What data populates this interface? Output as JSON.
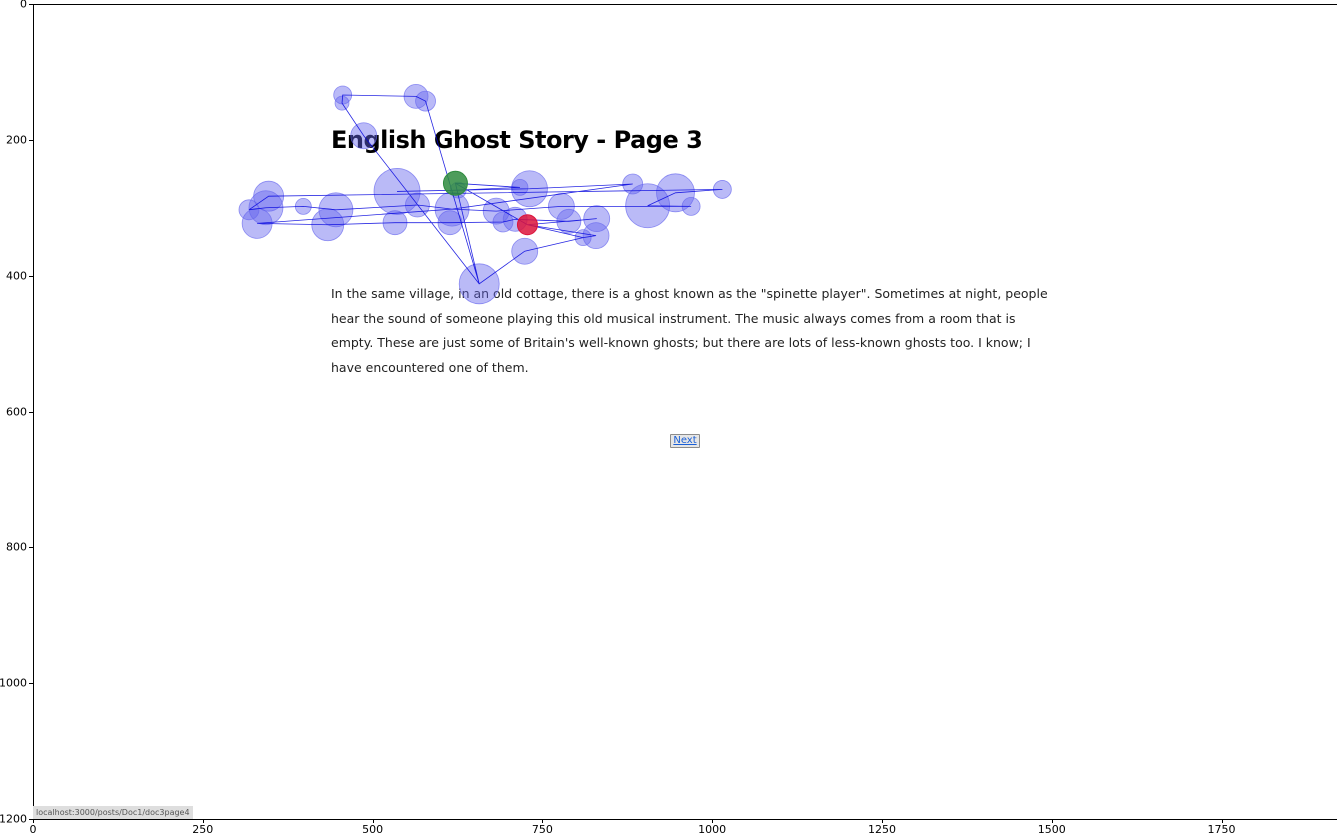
{
  "page": {
    "title": "English Ghost Story - Page 3",
    "paragraph": "In the same village, in an old cottage, there is a ghost known as the \"spinette player\". Sometimes at night, people hear the sound of someone playing this old musical instrument. The music always comes from a room that is empty. These are just some of Britain's well-known ghosts; but there are lots of less-known ghosts too. I know; I have encountered one of them.",
    "next_label": "Next"
  },
  "status_bar": {
    "url": "localhost:3000/posts/Doc1/doc3page4"
  },
  "chart_data": {
    "type": "scatter",
    "title": "",
    "xlabel": "",
    "ylabel": "",
    "xlim": [
      0,
      1920
    ],
    "ylim": [
      1200,
      0
    ],
    "x_ticks": [
      0,
      250,
      500,
      750,
      1000,
      1250,
      1500,
      1750
    ],
    "y_ticks": [
      0,
      200,
      400,
      600,
      800,
      1000,
      1200
    ],
    "grid": false,
    "colors": {
      "fixation": "#6666ee",
      "saccade": "#0000dd",
      "first_fixation": "#2e8b3e",
      "last_fixation": "#dc143c"
    },
    "fixations": [
      {
        "x": 622,
        "y": 264,
        "r": 12,
        "role": "first"
      },
      {
        "x": 626,
        "y": 274,
        "r": 8
      },
      {
        "x": 717,
        "y": 270,
        "r": 8
      },
      {
        "x": 731,
        "y": 272,
        "r": 18
      },
      {
        "x": 536,
        "y": 276,
        "r": 23
      },
      {
        "x": 347,
        "y": 283,
        "r": 15
      },
      {
        "x": 883,
        "y": 265,
        "r": 10
      },
      {
        "x": 946,
        "y": 278,
        "r": 19
      },
      {
        "x": 1015,
        "y": 273,
        "r": 9
      },
      {
        "x": 905,
        "y": 297,
        "r": 22
      },
      {
        "x": 969,
        "y": 298,
        "r": 9
      },
      {
        "x": 318,
        "y": 303,
        "r": 10
      },
      {
        "x": 343,
        "y": 300,
        "r": 17
      },
      {
        "x": 398,
        "y": 298,
        "r": 8
      },
      {
        "x": 446,
        "y": 303,
        "r": 17
      },
      {
        "x": 566,
        "y": 296,
        "r": 12
      },
      {
        "x": 617,
        "y": 302,
        "r": 17
      },
      {
        "x": 682,
        "y": 305,
        "r": 13
      },
      {
        "x": 778,
        "y": 298,
        "r": 13
      },
      {
        "x": 330,
        "y": 323,
        "r": 15
      },
      {
        "x": 434,
        "y": 325,
        "r": 16
      },
      {
        "x": 533,
        "y": 322,
        "r": 12
      },
      {
        "x": 614,
        "y": 322,
        "r": 12
      },
      {
        "x": 692,
        "y": 321,
        "r": 10
      },
      {
        "x": 710,
        "y": 317,
        "r": 12
      },
      {
        "x": 789,
        "y": 320,
        "r": 12
      },
      {
        "x": 830,
        "y": 316,
        "r": 13
      },
      {
        "x": 728,
        "y": 325,
        "r": 10,
        "role": "last"
      },
      {
        "x": 810,
        "y": 344,
        "r": 8
      },
      {
        "x": 829,
        "y": 341,
        "r": 13
      },
      {
        "x": 724,
        "y": 364,
        "r": 13
      },
      {
        "x": 657,
        "y": 412,
        "r": 20
      },
      {
        "x": 456,
        "y": 134,
        "r": 9
      },
      {
        "x": 564,
        "y": 136,
        "r": 12
      },
      {
        "x": 578,
        "y": 143,
        "r": 10
      },
      {
        "x": 455,
        "y": 146,
        "r": 7
      },
      {
        "x": 487,
        "y": 194,
        "r": 13
      }
    ],
    "scanpath": [
      [
        622,
        264
      ],
      [
        717,
        270
      ],
      [
        626,
        274
      ],
      [
        536,
        276
      ],
      [
        731,
        272
      ],
      [
        883,
        265
      ],
      [
        617,
        302
      ],
      [
        566,
        296
      ],
      [
        446,
        303
      ],
      [
        398,
        298
      ],
      [
        343,
        300
      ],
      [
        318,
        303
      ],
      [
        347,
        283
      ],
      [
        1015,
        273
      ],
      [
        946,
        278
      ],
      [
        905,
        297
      ],
      [
        969,
        298
      ],
      [
        778,
        298
      ],
      [
        682,
        305
      ],
      [
        617,
        302
      ],
      [
        330,
        323
      ],
      [
        434,
        325
      ],
      [
        533,
        322
      ],
      [
        614,
        322
      ],
      [
        692,
        321
      ],
      [
        710,
        317
      ],
      [
        789,
        320
      ],
      [
        830,
        316
      ],
      [
        728,
        325
      ],
      [
        829,
        341
      ],
      [
        810,
        344
      ],
      [
        724,
        364
      ],
      [
        657,
        412
      ],
      [
        657,
        412
      ],
      [
        578,
        143
      ],
      [
        564,
        136
      ],
      [
        456,
        134
      ],
      [
        455,
        146
      ],
      [
        487,
        194
      ],
      [
        657,
        412
      ],
      [
        622,
        264
      ],
      [
        728,
        325
      ],
      [
        810,
        344
      ],
      [
        724,
        364
      ]
    ]
  }
}
